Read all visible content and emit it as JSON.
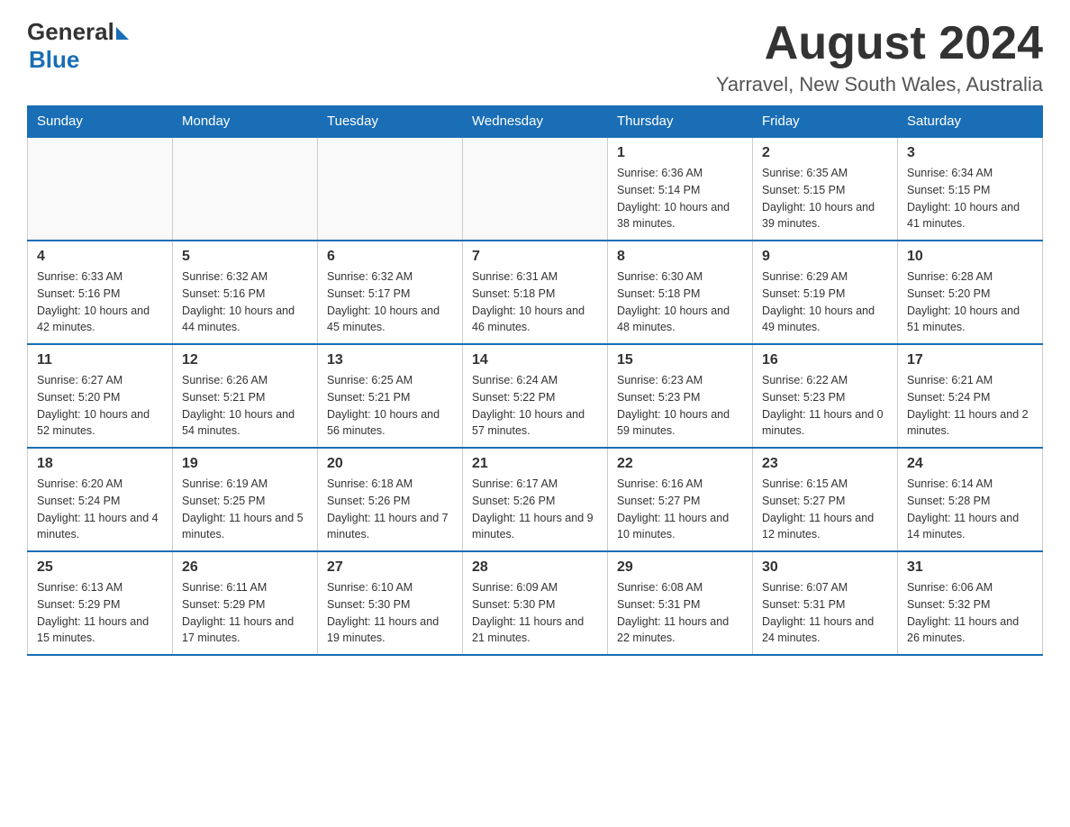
{
  "logo": {
    "general": "General",
    "blue": "Blue"
  },
  "title": "August 2024",
  "location": "Yarravel, New South Wales, Australia",
  "days_of_week": [
    "Sunday",
    "Monday",
    "Tuesday",
    "Wednesday",
    "Thursday",
    "Friday",
    "Saturday"
  ],
  "weeks": [
    [
      {
        "day": "",
        "info": ""
      },
      {
        "day": "",
        "info": ""
      },
      {
        "day": "",
        "info": ""
      },
      {
        "day": "",
        "info": ""
      },
      {
        "day": "1",
        "info": "Sunrise: 6:36 AM\nSunset: 5:14 PM\nDaylight: 10 hours and 38 minutes."
      },
      {
        "day": "2",
        "info": "Sunrise: 6:35 AM\nSunset: 5:15 PM\nDaylight: 10 hours and 39 minutes."
      },
      {
        "day": "3",
        "info": "Sunrise: 6:34 AM\nSunset: 5:15 PM\nDaylight: 10 hours and 41 minutes."
      }
    ],
    [
      {
        "day": "4",
        "info": "Sunrise: 6:33 AM\nSunset: 5:16 PM\nDaylight: 10 hours and 42 minutes."
      },
      {
        "day": "5",
        "info": "Sunrise: 6:32 AM\nSunset: 5:16 PM\nDaylight: 10 hours and 44 minutes."
      },
      {
        "day": "6",
        "info": "Sunrise: 6:32 AM\nSunset: 5:17 PM\nDaylight: 10 hours and 45 minutes."
      },
      {
        "day": "7",
        "info": "Sunrise: 6:31 AM\nSunset: 5:18 PM\nDaylight: 10 hours and 46 minutes."
      },
      {
        "day": "8",
        "info": "Sunrise: 6:30 AM\nSunset: 5:18 PM\nDaylight: 10 hours and 48 minutes."
      },
      {
        "day": "9",
        "info": "Sunrise: 6:29 AM\nSunset: 5:19 PM\nDaylight: 10 hours and 49 minutes."
      },
      {
        "day": "10",
        "info": "Sunrise: 6:28 AM\nSunset: 5:20 PM\nDaylight: 10 hours and 51 minutes."
      }
    ],
    [
      {
        "day": "11",
        "info": "Sunrise: 6:27 AM\nSunset: 5:20 PM\nDaylight: 10 hours and 52 minutes."
      },
      {
        "day": "12",
        "info": "Sunrise: 6:26 AM\nSunset: 5:21 PM\nDaylight: 10 hours and 54 minutes."
      },
      {
        "day": "13",
        "info": "Sunrise: 6:25 AM\nSunset: 5:21 PM\nDaylight: 10 hours and 56 minutes."
      },
      {
        "day": "14",
        "info": "Sunrise: 6:24 AM\nSunset: 5:22 PM\nDaylight: 10 hours and 57 minutes."
      },
      {
        "day": "15",
        "info": "Sunrise: 6:23 AM\nSunset: 5:23 PM\nDaylight: 10 hours and 59 minutes."
      },
      {
        "day": "16",
        "info": "Sunrise: 6:22 AM\nSunset: 5:23 PM\nDaylight: 11 hours and 0 minutes."
      },
      {
        "day": "17",
        "info": "Sunrise: 6:21 AM\nSunset: 5:24 PM\nDaylight: 11 hours and 2 minutes."
      }
    ],
    [
      {
        "day": "18",
        "info": "Sunrise: 6:20 AM\nSunset: 5:24 PM\nDaylight: 11 hours and 4 minutes."
      },
      {
        "day": "19",
        "info": "Sunrise: 6:19 AM\nSunset: 5:25 PM\nDaylight: 11 hours and 5 minutes."
      },
      {
        "day": "20",
        "info": "Sunrise: 6:18 AM\nSunset: 5:26 PM\nDaylight: 11 hours and 7 minutes."
      },
      {
        "day": "21",
        "info": "Sunrise: 6:17 AM\nSunset: 5:26 PM\nDaylight: 11 hours and 9 minutes."
      },
      {
        "day": "22",
        "info": "Sunrise: 6:16 AM\nSunset: 5:27 PM\nDaylight: 11 hours and 10 minutes."
      },
      {
        "day": "23",
        "info": "Sunrise: 6:15 AM\nSunset: 5:27 PM\nDaylight: 11 hours and 12 minutes."
      },
      {
        "day": "24",
        "info": "Sunrise: 6:14 AM\nSunset: 5:28 PM\nDaylight: 11 hours and 14 minutes."
      }
    ],
    [
      {
        "day": "25",
        "info": "Sunrise: 6:13 AM\nSunset: 5:29 PM\nDaylight: 11 hours and 15 minutes."
      },
      {
        "day": "26",
        "info": "Sunrise: 6:11 AM\nSunset: 5:29 PM\nDaylight: 11 hours and 17 minutes."
      },
      {
        "day": "27",
        "info": "Sunrise: 6:10 AM\nSunset: 5:30 PM\nDaylight: 11 hours and 19 minutes."
      },
      {
        "day": "28",
        "info": "Sunrise: 6:09 AM\nSunset: 5:30 PM\nDaylight: 11 hours and 21 minutes."
      },
      {
        "day": "29",
        "info": "Sunrise: 6:08 AM\nSunset: 5:31 PM\nDaylight: 11 hours and 22 minutes."
      },
      {
        "day": "30",
        "info": "Sunrise: 6:07 AM\nSunset: 5:31 PM\nDaylight: 11 hours and 24 minutes."
      },
      {
        "day": "31",
        "info": "Sunrise: 6:06 AM\nSunset: 5:32 PM\nDaylight: 11 hours and 26 minutes."
      }
    ]
  ]
}
